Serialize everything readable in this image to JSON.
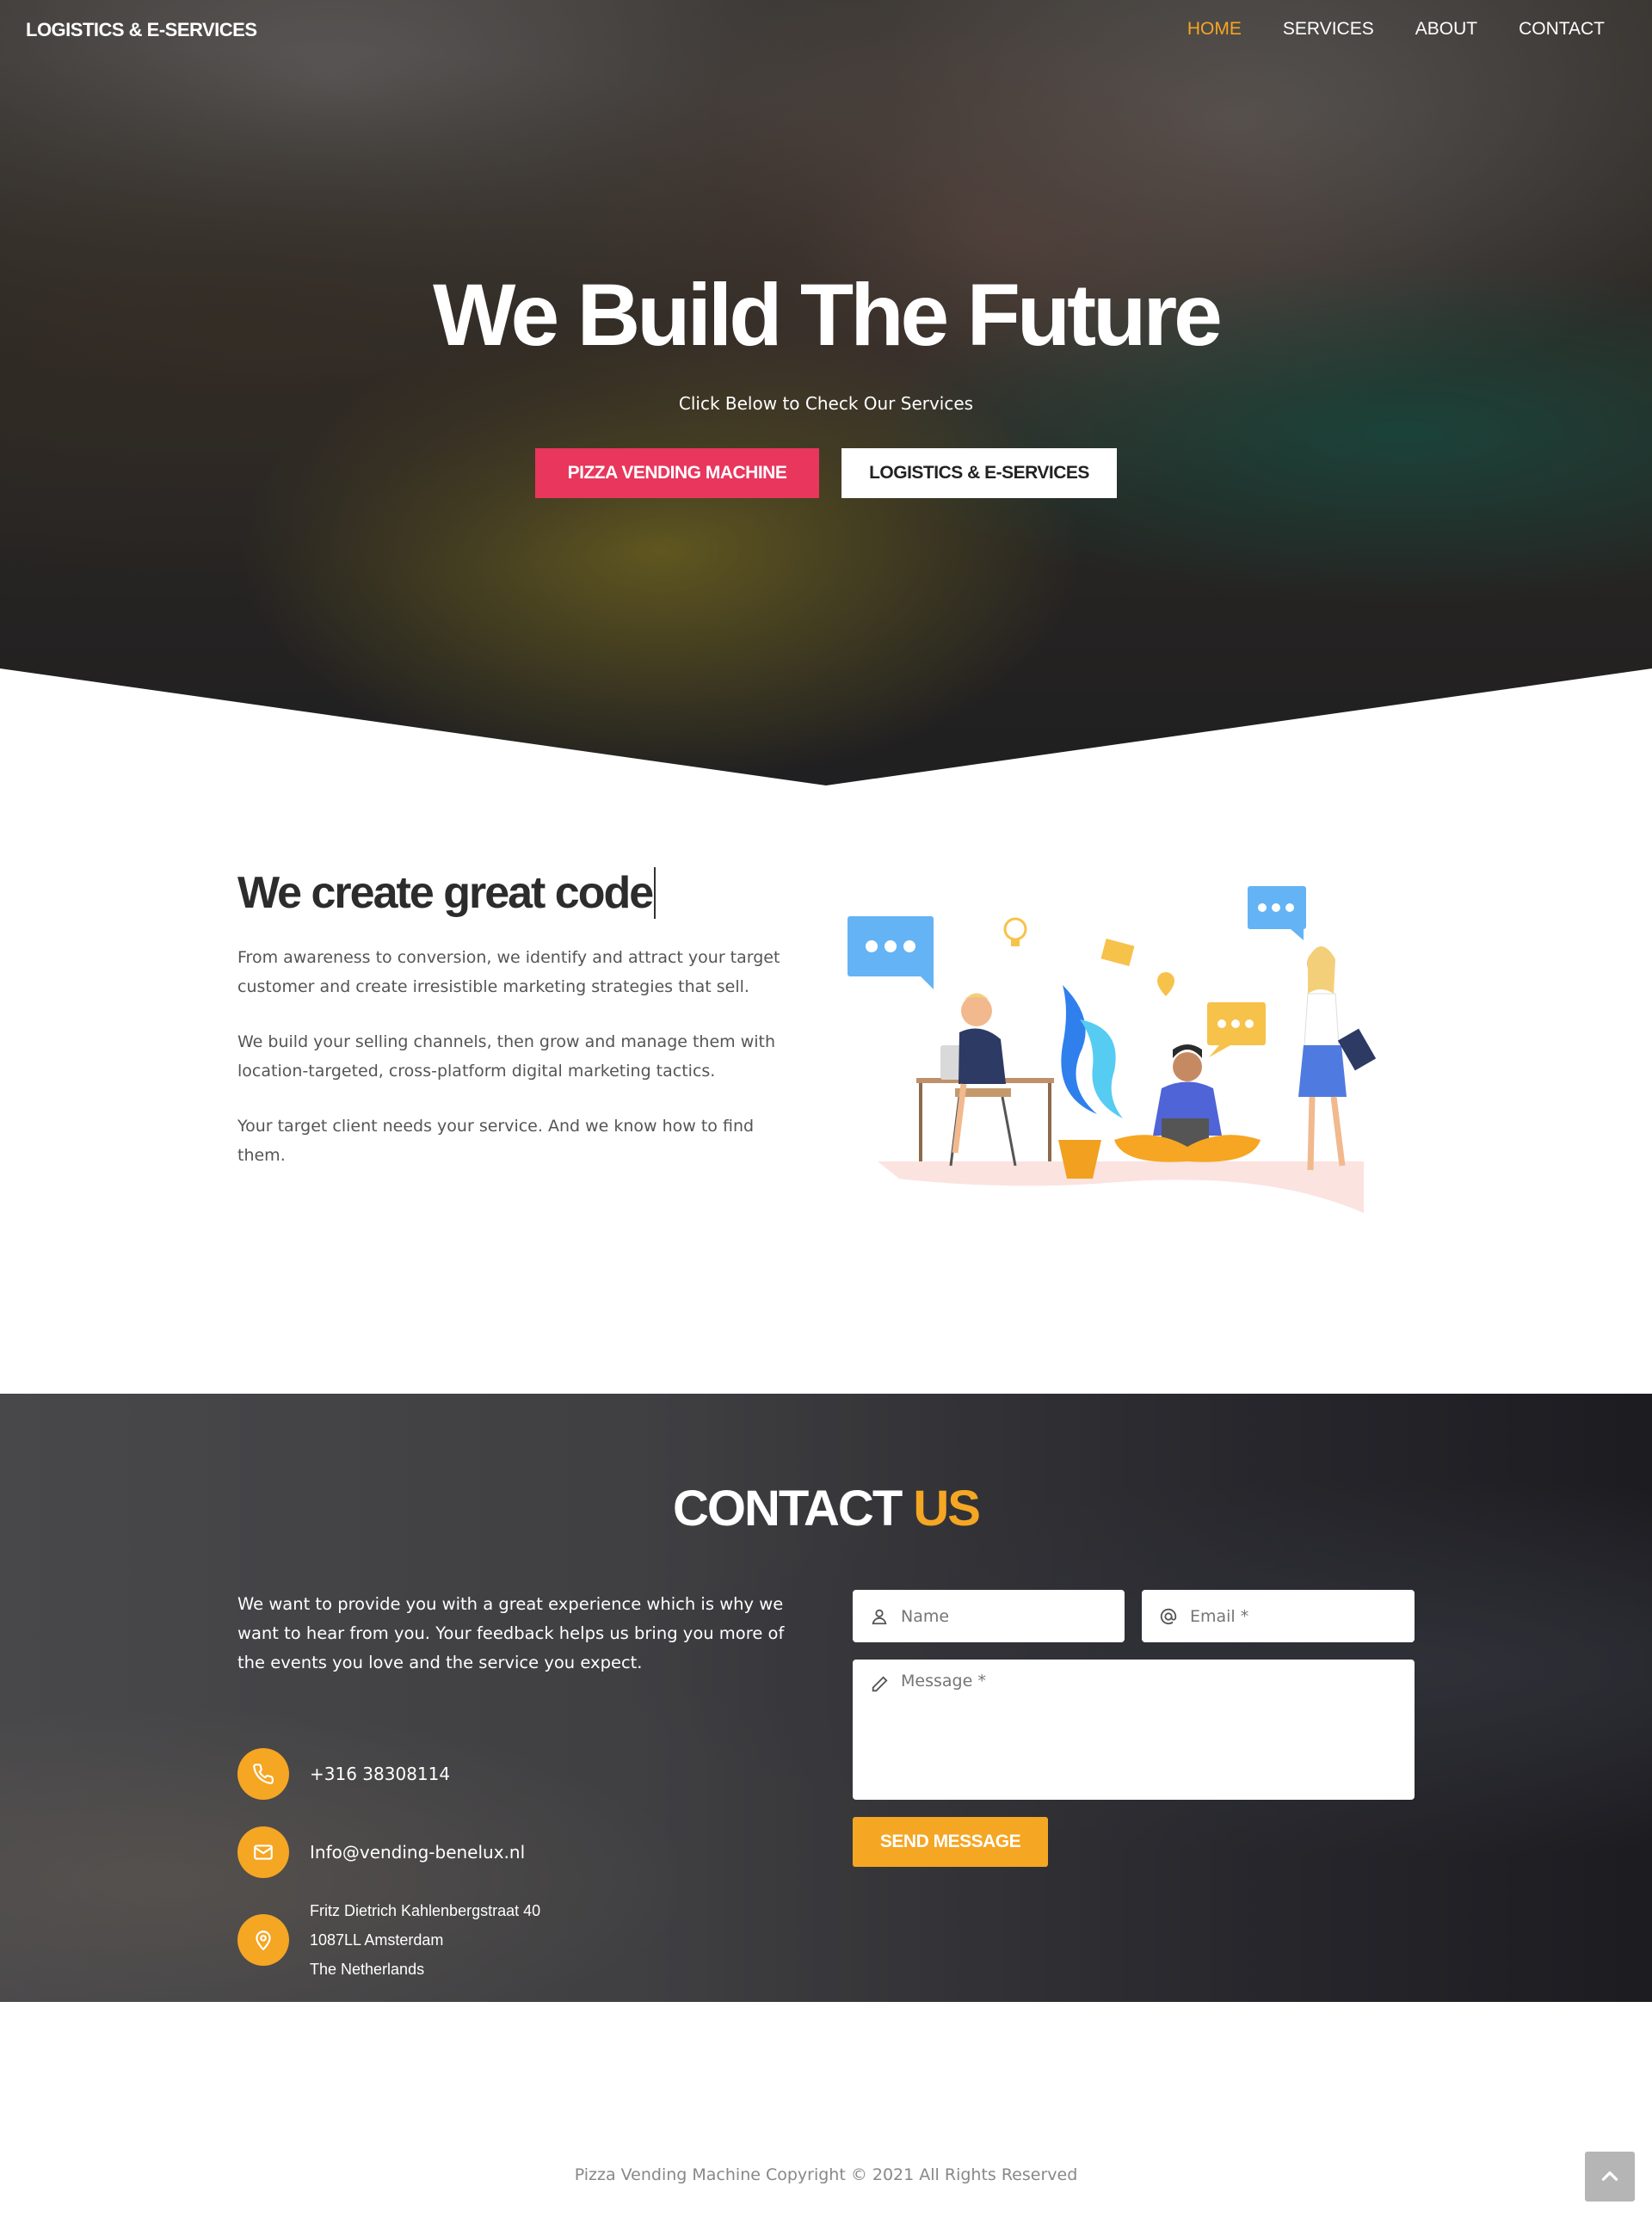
{
  "nav": {
    "brand": "LOGISTICS & E-SERVICES",
    "links": [
      "HOME",
      "SERVICES",
      "ABOUT",
      "CONTACT"
    ],
    "active": "HOME"
  },
  "hero": {
    "title": "We Build The Future",
    "subtitle": "Click Below to Check Our Services",
    "button_primary": "PIZZA VENDING MACHINE",
    "button_secondary": "LOGISTICS & E-SERVICES"
  },
  "about": {
    "title": "We create great code",
    "paragraphs": [
      "From awareness to conversion, we identify and attract your target customer and create irresistible marketing strategies that sell.",
      "We build your selling channels, then grow and manage them with location-targeted, cross-platform digital marketing tactics.",
      "Your target client needs your service. And we know how to find them."
    ]
  },
  "contact": {
    "title_main": "CONTACT",
    "title_accent": "US",
    "intro": "We want to provide you with a great experience which is why we want to hear from you. Your feedback helps us bring you more of the events you love and the service you expect.",
    "phone": "+316 38308114",
    "email": "Info@vending-benelux.nl",
    "address": [
      "Fritz Dietrich Kahlenbergstraat 40",
      "1087LL Amsterdam",
      "The Netherlands"
    ],
    "form": {
      "name_placeholder": "Name",
      "email_placeholder": "Email *",
      "message_placeholder": "Message *",
      "send_label": "SEND MESSAGE"
    }
  },
  "footer": {
    "copyright": "Pizza Vending Machine Copyright © 2021 All Rights Reserved"
  },
  "colors": {
    "accent": "#f5a623",
    "primary_button": "#e8365d"
  },
  "icons": [
    "phone-icon",
    "envelope-icon",
    "map-pin-icon",
    "user-icon",
    "at-icon",
    "pencil-icon",
    "chevron-up-icon"
  ]
}
